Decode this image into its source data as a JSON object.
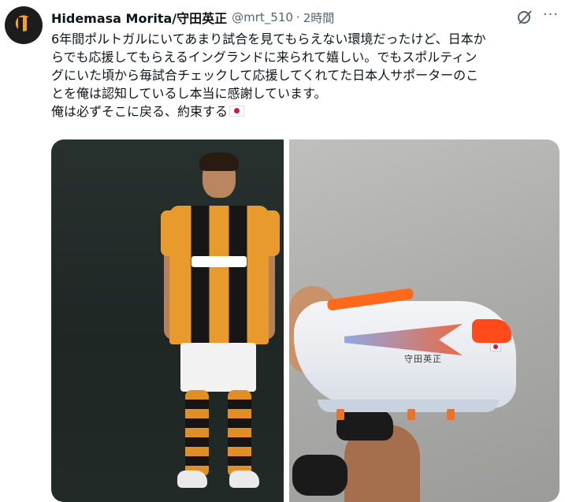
{
  "tweet": {
    "author_name": "Hidemasa Morita/守田英正",
    "handle": "@mrt_510",
    "time": "2時間",
    "separator": "·",
    "text_lines": [
      "6年間ポルトガルにいてあまり試合を見てもらえない環境だったけど、日本か",
      "らでも応援してもらえるイングランドに来られて嬉しい。でもスポルティン",
      "グにいた頃から毎試合チェックして応援してくれてた日本人サポーターのこ",
      "とを俺は認知しているし本当に感謝しています。",
      "俺は必ずそこに戻る、約束する"
    ],
    "more_label": "···"
  },
  "media": {
    "boot_name": "守田英正"
  },
  "colors": {
    "text": "#0f1419",
    "secondary": "#536471",
    "jersey_orange": "#e89a2c",
    "boot_accent": "#ff4a1c"
  },
  "icons": [
    "grok-icon",
    "more-icon",
    "japan-flag-icon"
  ]
}
